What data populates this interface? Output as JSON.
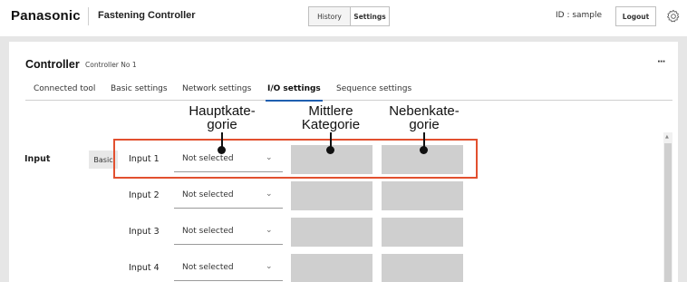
{
  "header": {
    "brand": "Panasonic",
    "app_title": "Fastening Controller",
    "history_label": "History",
    "settings_label": "Settings",
    "user_id": "ID : sample",
    "logout_label": "Logout",
    "settings_icon": "gear-icon"
  },
  "panel": {
    "title": "Controller",
    "subtitle": "Controller No 1",
    "more_label": "···",
    "tabs": [
      {
        "label": "Connected tool",
        "active": false
      },
      {
        "label": "Basic settings",
        "active": false
      },
      {
        "label": "Network settings",
        "active": false
      },
      {
        "label": "I/O settings",
        "active": true
      },
      {
        "label": "Sequence settings",
        "active": false
      }
    ]
  },
  "io": {
    "section_label": "Input",
    "badge": "Basic",
    "rows": [
      {
        "label": "Input 1",
        "select_value": "Not selected"
      },
      {
        "label": "Input 2",
        "select_value": "Not selected"
      },
      {
        "label": "Input 3",
        "select_value": "Not selected"
      },
      {
        "label": "Input 4",
        "select_value": "Not selected"
      }
    ]
  },
  "annotations": {
    "main_category": [
      "Hauptkate-",
      "gorie"
    ],
    "middle_category": [
      "Mittlere",
      "Kategorie"
    ],
    "sub_category": [
      "Nebenkate-",
      "gorie"
    ]
  },
  "colors": {
    "highlight": "#e2502f",
    "active_tab_underline": "#1f5fb0",
    "disabled_box": "#cfcfcf"
  }
}
